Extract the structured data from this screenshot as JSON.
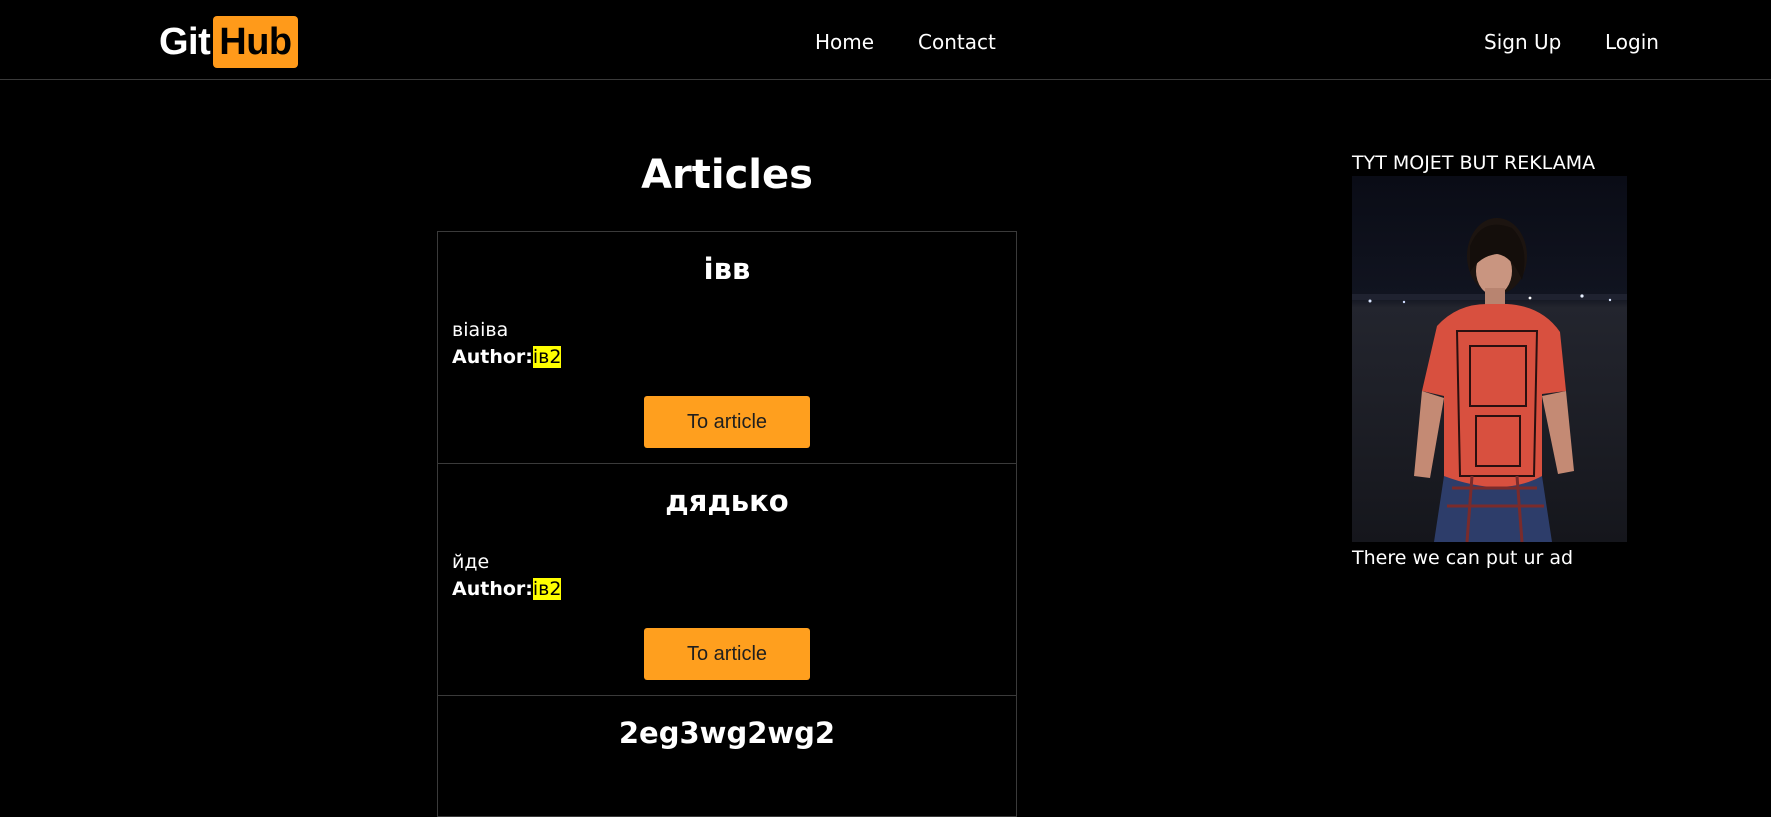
{
  "navbar": {
    "logo_left": "Git",
    "logo_right": "Hub",
    "links": [
      "Home",
      "Contact"
    ],
    "auth": [
      "Sign Up",
      "Login"
    ]
  },
  "main": {
    "title": "Articles",
    "articles": [
      {
        "title": "івв",
        "body": "віаіва",
        "author_label": "Author:",
        "author": "ів2",
        "button": "To article"
      },
      {
        "title": "дядько",
        "body": "йде",
        "author_label": "Author:",
        "author": "ів2",
        "button": "To article"
      },
      {
        "title": "2eg3wg2wg2"
      }
    ]
  },
  "sidebar": {
    "ad_title": "TYT MOJET BUT REKLAMA",
    "ad_caption": "There we can put ur ad"
  },
  "colors": {
    "accent": "#ff9a1a",
    "highlight": "#ffff00",
    "background": "#000000"
  }
}
